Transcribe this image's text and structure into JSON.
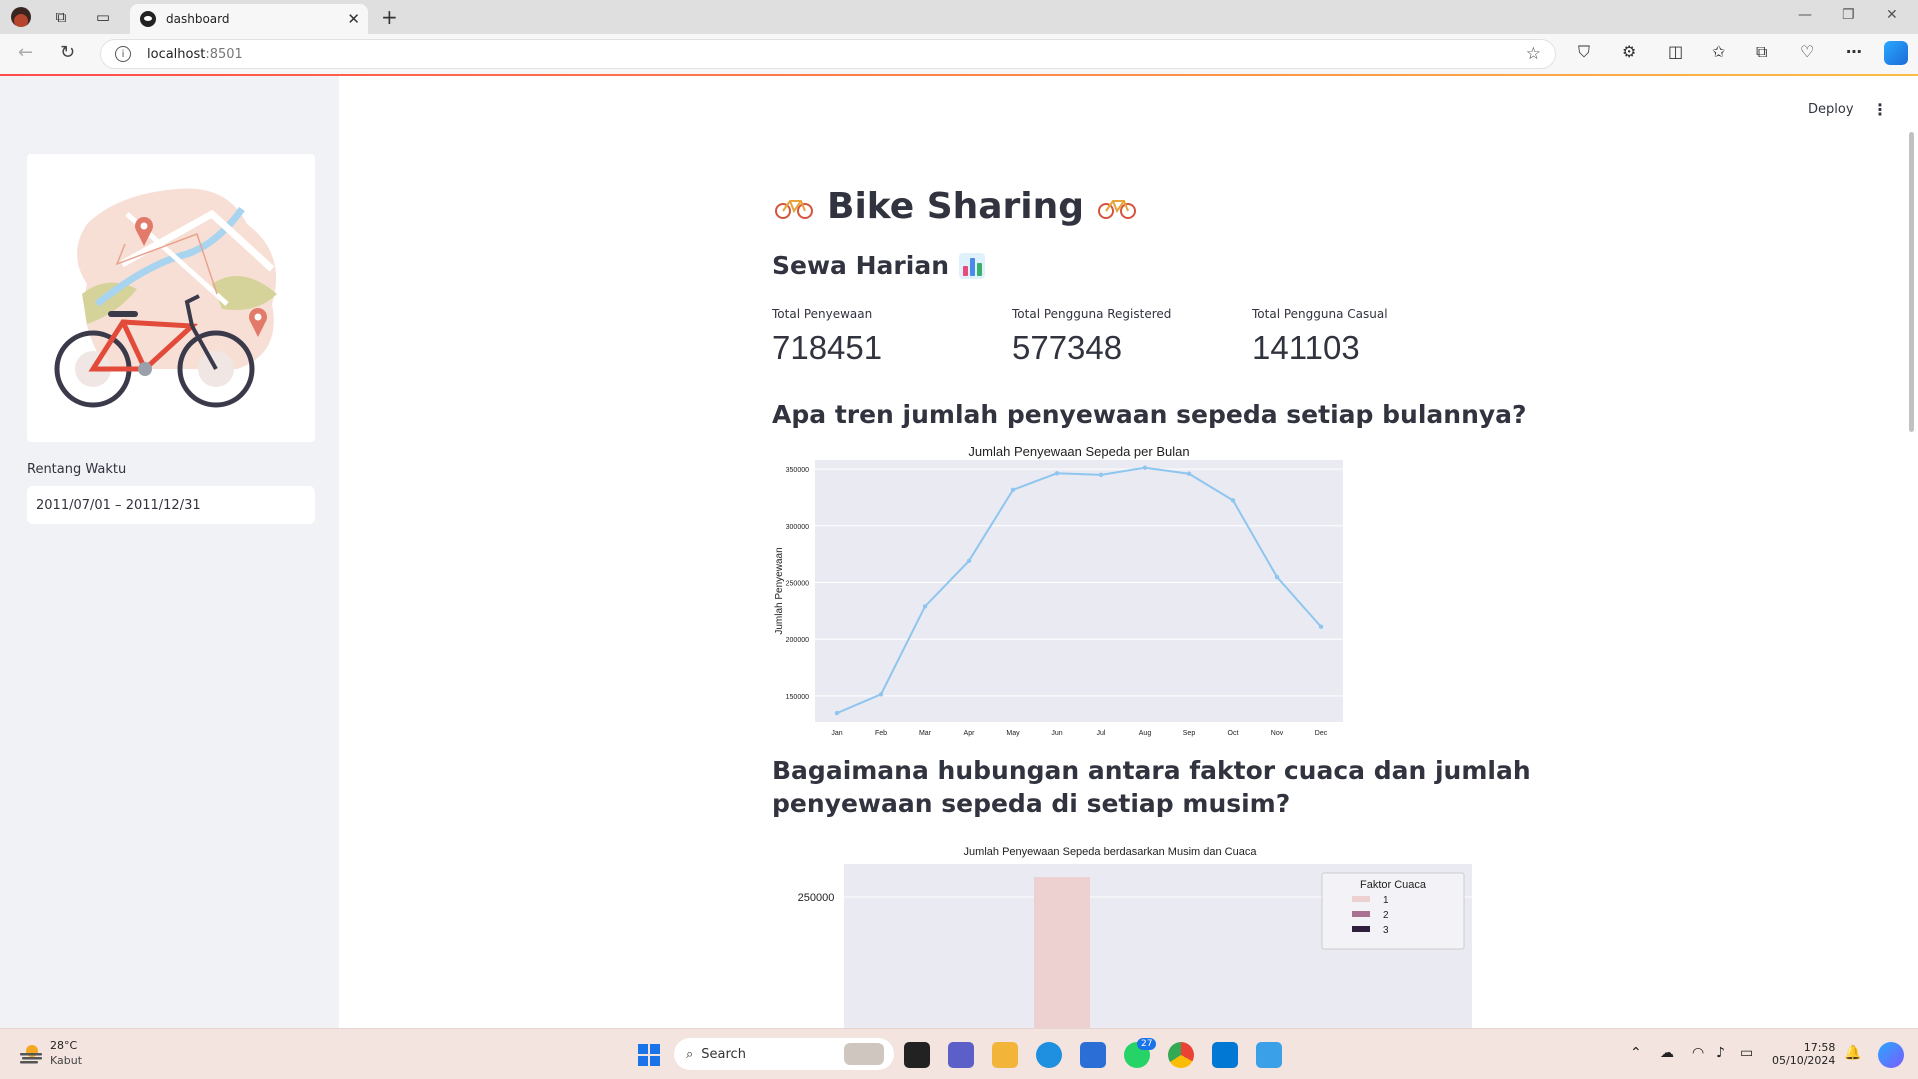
{
  "browser": {
    "tab_title": "dashboard",
    "url_host": "localhost",
    "url_port": ":8501"
  },
  "app": {
    "deploy_label": "Deploy",
    "sidebar": {
      "date_label": "Rentang Waktu",
      "date_value": "2011/07/01 – 2011/12/31"
    },
    "title": "Bike Sharing",
    "subheader": "Sewa Harian",
    "metrics": [
      {
        "label": "Total Penyewaan",
        "value": "718451"
      },
      {
        "label": "Total Pengguna Registered",
        "value": "577348"
      },
      {
        "label": "Total Pengguna Casual",
        "value": "141103"
      }
    ],
    "q1": "Apa tren jumlah penyewaan sepeda setiap bulannya?",
    "q2_line1": "Bagaimana hubungan antara faktor cuaca dan jumlah",
    "q2_line2": "penyewaan sepeda di setiap musim?"
  },
  "chart_data": [
    {
      "type": "line",
      "title": "Jumlah Penyewaan Sepeda per Bulan",
      "xlabel": "",
      "ylabel": "Jumlah Penyewaan",
      "categories": [
        "Jan",
        "Feb",
        "Mar",
        "Apr",
        "May",
        "Jun",
        "Jul",
        "Aug",
        "Sep",
        "Oct",
        "Nov",
        "Dec"
      ],
      "values": [
        134900,
        151400,
        228900,
        269100,
        331700,
        346300,
        344900,
        351200,
        345900,
        322400,
        254800,
        211000
      ],
      "yticks": [
        150000,
        200000,
        250000,
        300000,
        350000
      ],
      "ylim": [
        127000,
        358000
      ],
      "grid": true,
      "line_color": "#8ec6f0"
    },
    {
      "type": "bar",
      "title": "Jumlah Penyewaan Sepeda berdasarkan Musim dan Cuaca",
      "legend_title": "Faktor Cuaca",
      "legend_position": "top-right",
      "series": [
        {
          "name": "1",
          "color": "#ecd1d0"
        },
        {
          "name": "2",
          "color": "#a8718f"
        },
        {
          "name": "3",
          "color": "#2f1e3d"
        }
      ],
      "yticks": [
        250000
      ],
      "visible_bar_value": 260000
    }
  ],
  "taskbar": {
    "temp": "28°C",
    "weather": "Kabut",
    "search_placeholder": "Search",
    "time": "17:58",
    "date": "05/10/2024",
    "whatsapp_badge": "27"
  }
}
